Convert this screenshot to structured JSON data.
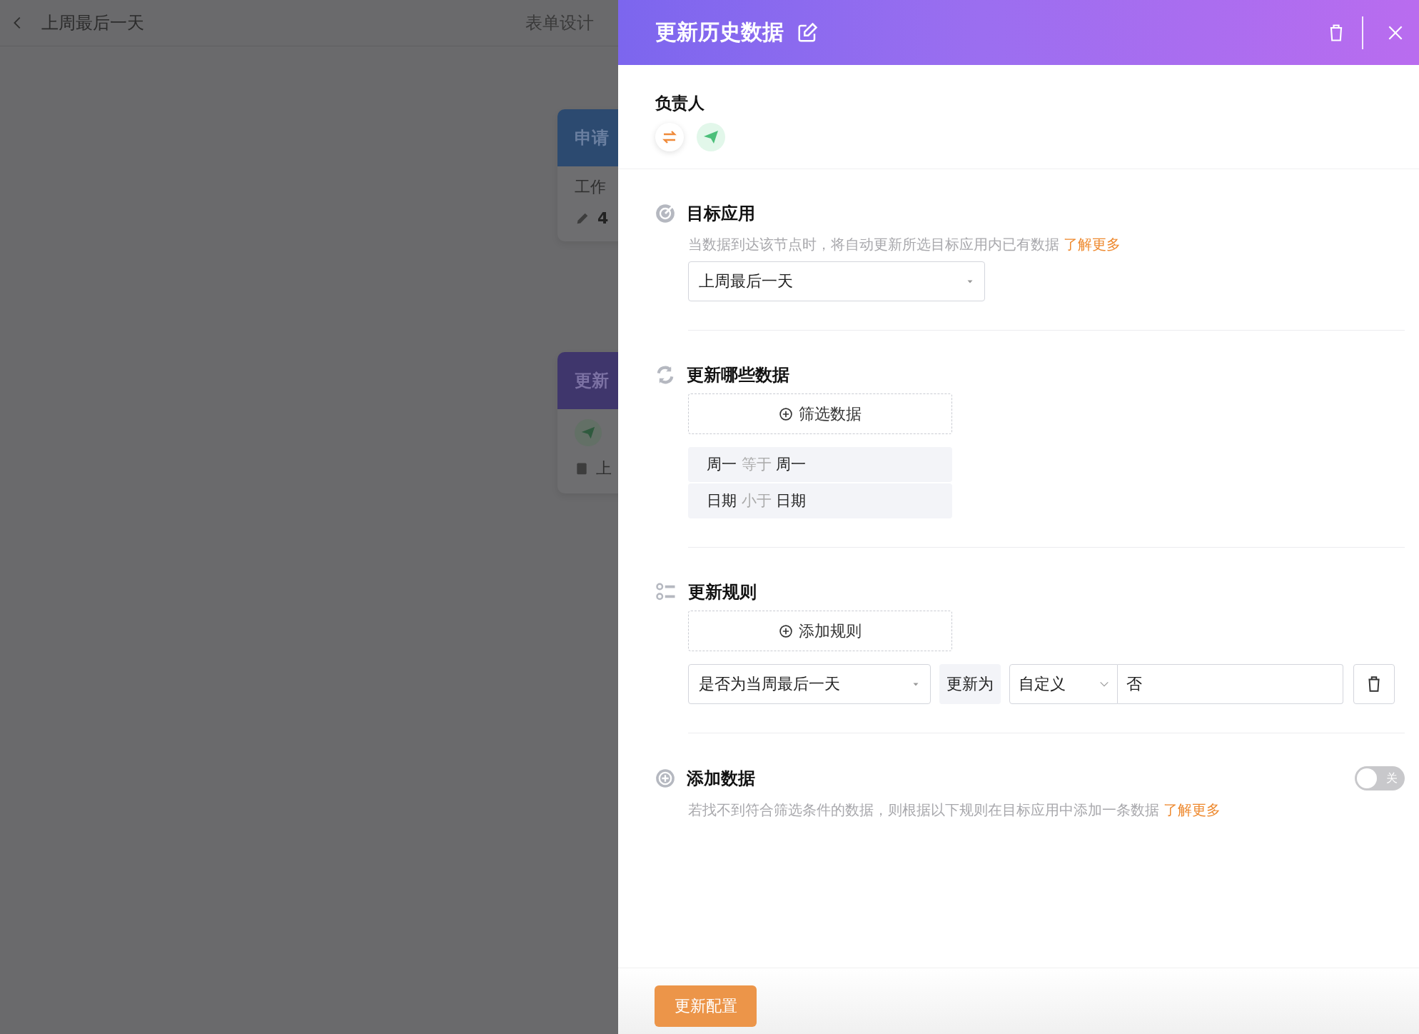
{
  "background": {
    "top_bar": {
      "title": "上周最后一天",
      "tab": "表单设计"
    },
    "nodes": [
      {
        "kind": "approval",
        "title": "申请",
        "body": "工作",
        "count": "4"
      },
      {
        "kind": "update",
        "body": "上",
        "title": "更新"
      }
    ]
  },
  "panel": {
    "title": "更新历史数据",
    "owner": {
      "label": "负责人"
    },
    "target_app": {
      "title": "目标应用",
      "description": "当数据到达该节点时，将自动更新所选目标应用内已有数据",
      "link": "了解更多",
      "select": "上周最后一天"
    },
    "filter": {
      "title": "更新哪些数据",
      "add_button": "筛选数据",
      "conditions": [
        {
          "field": "周一",
          "operator": "等于",
          "value": "周一"
        },
        {
          "field": "日期",
          "operator": "小于",
          "value": "日期"
        }
      ]
    },
    "rules": {
      "title": "更新规则",
      "add_button": "添加规则",
      "items": [
        {
          "field": "是否为当周最后一天",
          "connector": "更新为",
          "mode": "自定义",
          "value": "否"
        }
      ]
    },
    "add_data": {
      "title": "添加数据",
      "toggle": {
        "on": false,
        "label": "关"
      },
      "description": "若找不到符合筛选条件的数据，则根据以下规则在目标应用中添加一条数据",
      "link": "了解更多"
    },
    "footer": {
      "button": "更新配置"
    }
  }
}
